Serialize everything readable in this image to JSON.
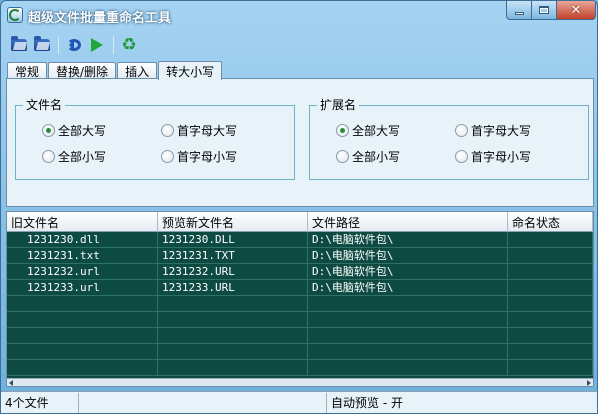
{
  "window": {
    "title": "超级文件批量重命名工具"
  },
  "toolbar": {
    "icons": [
      "open-folder-icon",
      "open-folder-alt-icon",
      "undo-icon",
      "play-icon",
      "recycle-icon"
    ]
  },
  "tabs": [
    {
      "label": "常规",
      "active": false
    },
    {
      "label": "替换/删除",
      "active": false
    },
    {
      "label": "插入",
      "active": false
    },
    {
      "label": "转大小写",
      "active": true
    }
  ],
  "groups": {
    "filename": {
      "title": "文件名",
      "options": [
        {
          "label": "全部大写",
          "checked": true
        },
        {
          "label": "首字母大写",
          "checked": false
        },
        {
          "label": "全部小写",
          "checked": false
        },
        {
          "label": "首字母小写",
          "checked": false
        }
      ]
    },
    "extension": {
      "title": "扩展名",
      "options": [
        {
          "label": "全部大写",
          "checked": true
        },
        {
          "label": "首字母大写",
          "checked": false
        },
        {
          "label": "全部小写",
          "checked": false
        },
        {
          "label": "首字母小写",
          "checked": false
        }
      ]
    }
  },
  "table": {
    "columns": [
      "旧文件名",
      "预览新文件名",
      "文件路径",
      "命名状态"
    ],
    "rows": [
      [
        "1231230.dll",
        "1231230.DLL",
        "D:\\电脑软件包\\",
        ""
      ],
      [
        "1231231.txt",
        "1231231.TXT",
        "D:\\电脑软件包\\",
        ""
      ],
      [
        "1231232.url",
        "1231232.URL",
        "D:\\电脑软件包\\",
        ""
      ],
      [
        "1231233.url",
        "1231233.URL",
        "D:\\电脑软件包\\",
        ""
      ]
    ]
  },
  "status": {
    "file_count": "4个文件",
    "middle": "",
    "preview": "自动预览 - 开"
  },
  "colors": {
    "grid_background": "#0d4a42",
    "panel_background": "#e8f3f9",
    "accent": "#6db0dc"
  }
}
